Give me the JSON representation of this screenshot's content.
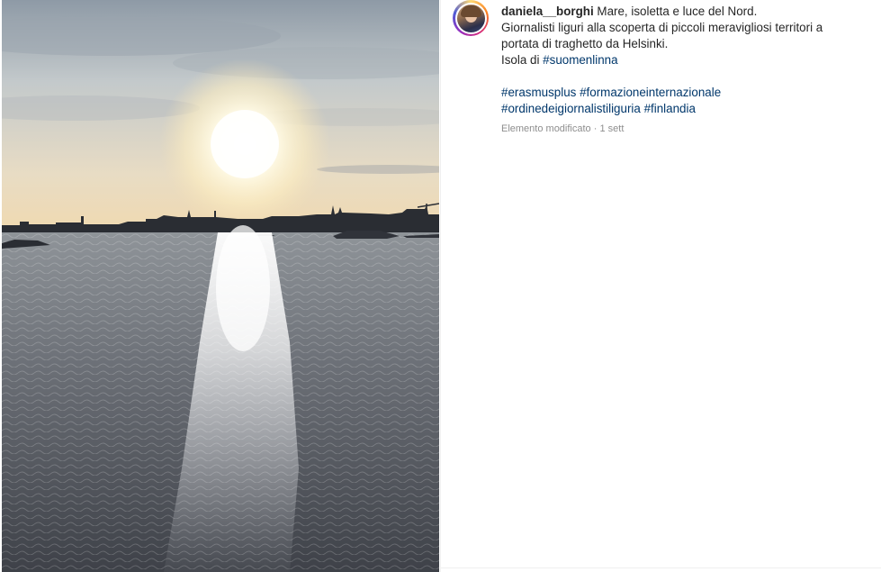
{
  "post": {
    "username": "daniela__borghi",
    "caption_line1_text": "Mare, isoletta e luce del Nord.",
    "caption_line2": "Giornalisti liguri alla scoperta di piccoli meravigliosi territori a",
    "caption_line3": "portata di traghetto da Helsinki.",
    "caption_line4_prefix": "Isola di",
    "hashtags": [
      "#suomenlinna",
      "#erasmusplus",
      "#formazioneinternazionale",
      "#ordinedeigiornalistiliguria",
      "#finlandia"
    ],
    "meta_edited": "Elemento modificato",
    "meta_separator": "·",
    "meta_time": "1 sett"
  },
  "colors": {
    "hashtag": "#00376b",
    "text": "#262626",
    "meta": "#8e8e8e"
  }
}
